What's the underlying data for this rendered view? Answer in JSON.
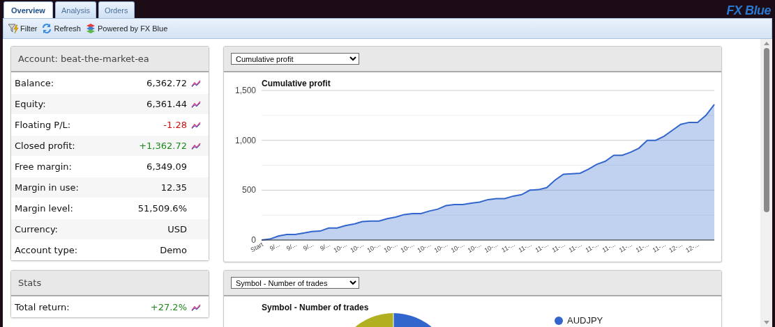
{
  "tabs": [
    {
      "label": "Overview",
      "selected": true
    },
    {
      "label": "Analysis",
      "selected": false
    },
    {
      "label": "Orders",
      "selected": false
    }
  ],
  "brand": "FX Blue",
  "toolbar": [
    {
      "kind": "filter",
      "label": "Filter"
    },
    {
      "kind": "refresh",
      "label": "Refresh"
    },
    {
      "kind": "powered",
      "label": "Powered by FX Blue"
    }
  ],
  "account_panel": {
    "title": "Account: beat-the-market-ea",
    "rows": [
      {
        "label": "Balance:",
        "value": "6,362.72",
        "color": "#111111",
        "chart_link": true
      },
      {
        "label": "Equity:",
        "value": "6,361.44",
        "color": "#111111",
        "chart_link": true
      },
      {
        "label": "Floating P/L:",
        "value": "-1.28",
        "color": "#cc1010",
        "chart_link": true
      },
      {
        "label": "Closed profit:",
        "value": "+1,362.72",
        "color": "#1a8a1a",
        "chart_link": true
      },
      {
        "label": "Free margin:",
        "value": "6,349.09",
        "color": "#111111",
        "chart_link": false
      },
      {
        "label": "Margin in use:",
        "value": "12.35",
        "color": "#111111",
        "chart_link": false
      },
      {
        "label": "Margin level:",
        "value": "51,509.6%",
        "color": "#111111",
        "chart_link": false
      },
      {
        "label": "Currency:",
        "value": "USD",
        "color": "#111111",
        "chart_link": false
      },
      {
        "label": "Account type:",
        "value": "Demo",
        "color": "#111111",
        "chart_link": false
      }
    ]
  },
  "stats_panel": {
    "title": "Stats",
    "rows": [
      {
        "label": "Total return:",
        "value": "+27.2%",
        "color": "#1a8a1a",
        "chart_link": true
      }
    ]
  },
  "chart_panel": {
    "select": "Cumulative profit",
    "chart_data": {
      "type": "area",
      "title": "Cumulative profit",
      "categories": [
        "Start",
        null,
        "9/...",
        null,
        "9/...",
        null,
        "9/...",
        null,
        "9/...",
        null,
        "10-...",
        null,
        "10-...",
        null,
        "10-...",
        null,
        "10-...",
        null,
        "10-...",
        null,
        "10-...",
        null,
        "10-...",
        null,
        "10-...",
        null,
        "10-...",
        null,
        "10-...",
        null,
        "11-...",
        null,
        "11-...",
        null,
        "11-...",
        null,
        "11-...",
        null,
        "11-...",
        null,
        "11-...",
        null,
        "11-...",
        null,
        "11-...",
        null,
        "11-...",
        null,
        "11-...",
        null,
        "12-...",
        null,
        "12-...",
        null,
        null
      ],
      "series": [
        {
          "color": "#3366cc",
          "values": [
            0,
            10,
            40,
            55,
            55,
            70,
            85,
            90,
            120,
            120,
            145,
            160,
            185,
            190,
            190,
            215,
            230,
            255,
            265,
            265,
            290,
            310,
            345,
            355,
            355,
            370,
            380,
            405,
            415,
            415,
            440,
            455,
            500,
            505,
            525,
            600,
            660,
            665,
            670,
            710,
            760,
            790,
            850,
            850,
            880,
            920,
            1000,
            1000,
            1040,
            1100,
            1160,
            1180,
            1180,
            1250,
            1360
          ]
        }
      ],
      "ylim": [
        0,
        1500
      ],
      "yticks": [
        {
          "value": 0,
          "label": "0"
        },
        {
          "value": 500,
          "label": "500"
        },
        {
          "value": 1000,
          "label": "1,000"
        },
        {
          "value": 1500,
          "label": "1,500"
        }
      ]
    }
  },
  "pie_panel": {
    "select": "Symbol - Number of trades",
    "title": "Symbol - Number of trades",
    "legend": [
      {
        "label": "AUDJPY",
        "color": "#3366cc"
      }
    ]
  }
}
